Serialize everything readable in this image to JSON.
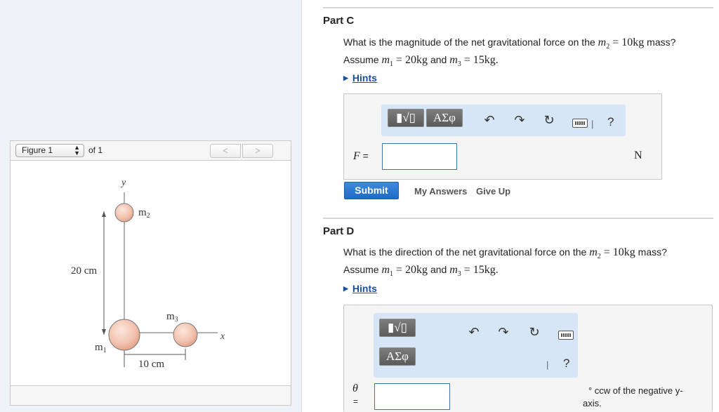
{
  "figure": {
    "selector_label": "Figure 1",
    "of_text": "of 1",
    "prev_label": "<",
    "next_label": ">",
    "labels": {
      "y_axis": "y",
      "x_axis": "x",
      "m1": "m",
      "m1_sub": "1",
      "m2": "m",
      "m2_sub": "2",
      "m3": "m",
      "m3_sub": "3",
      "dist_vertical": "20 cm",
      "dist_horizontal": "10 cm"
    }
  },
  "part_c": {
    "title": "Part C",
    "q_line1_pre": "What is the magnitude of the net gravitational force on the ",
    "q_var": "m",
    "q_var_sub": "2",
    "q_eq": " = 10kg",
    "q_line1_post": " mass?",
    "q_line2_pre": "Assume ",
    "q_m1_var": "m",
    "q_m1_sub": "1",
    "q_m1_eq": " = 20kg",
    "q_and": " and ",
    "q_m3_var": "m",
    "q_m3_sub": "3",
    "q_m3_eq": " = 15kg.",
    "hints": "Hints",
    "toolbar": {
      "template_btn": "▮√▯",
      "greek_btn": "ΑΣφ",
      "help": "?",
      "sep": "|"
    },
    "variable": "F",
    "equals": " =",
    "input_value": "",
    "unit": "N",
    "submit": "Submit",
    "my_answers": "My Answers",
    "give_up": "Give Up"
  },
  "part_d": {
    "title": "Part D",
    "q_line1_pre": "What is the direction of the net gravitational force on the ",
    "q_var": "m",
    "q_var_sub": "2",
    "q_eq": " = 10kg",
    "q_line1_post": " mass?",
    "q_line2_pre": "Assume ",
    "q_m1_var": "m",
    "q_m1_sub": "1",
    "q_m1_eq": " = 20kg",
    "q_and": " and ",
    "q_m3_var": "m",
    "q_m3_sub": "3",
    "q_m3_eq": " = 15kg.",
    "hints": "Hints",
    "toolbar": {
      "template_btn": "▮√▯",
      "greek_btn": "ΑΣφ",
      "help": "?",
      "sep": "|"
    },
    "variable": "θ",
    "equals": "=",
    "input_value": "",
    "unit_line1": "° ccw of the negative y-",
    "unit_line2": "axis."
  }
}
